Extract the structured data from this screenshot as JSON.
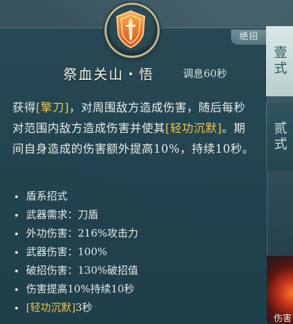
{
  "skill": {
    "badge": "绝招",
    "name": "祭血关山・悟",
    "cooldown": "调息60秒",
    "emblem_icon": "shield-sword-icon"
  },
  "description": {
    "p1": "获得",
    "h1": "[擎刀]",
    "p2": "，对周围敌方造成伤害，随后每秒对范围内敌方造成伤害并使其",
    "h2": "[轻功沉默]",
    "p3": "。期间自身造成的伤害额外提高10%，持续10秒。"
  },
  "attributes": [
    "盾系招式",
    "武器需求：刀盾",
    "外功伤害：216%攻击力",
    "武器伤害：100%",
    "破招伤害：130%破招值",
    "伤害提高10%持续10秒"
  ],
  "silence_attr": {
    "tag": "[轻功沉默]",
    "duration": "3秒"
  },
  "tabs": [
    "壹式",
    "贰式"
  ],
  "side_skill_label": "伤害",
  "colors": {
    "highlight": "#f2c648",
    "text": "#eaeee9"
  }
}
